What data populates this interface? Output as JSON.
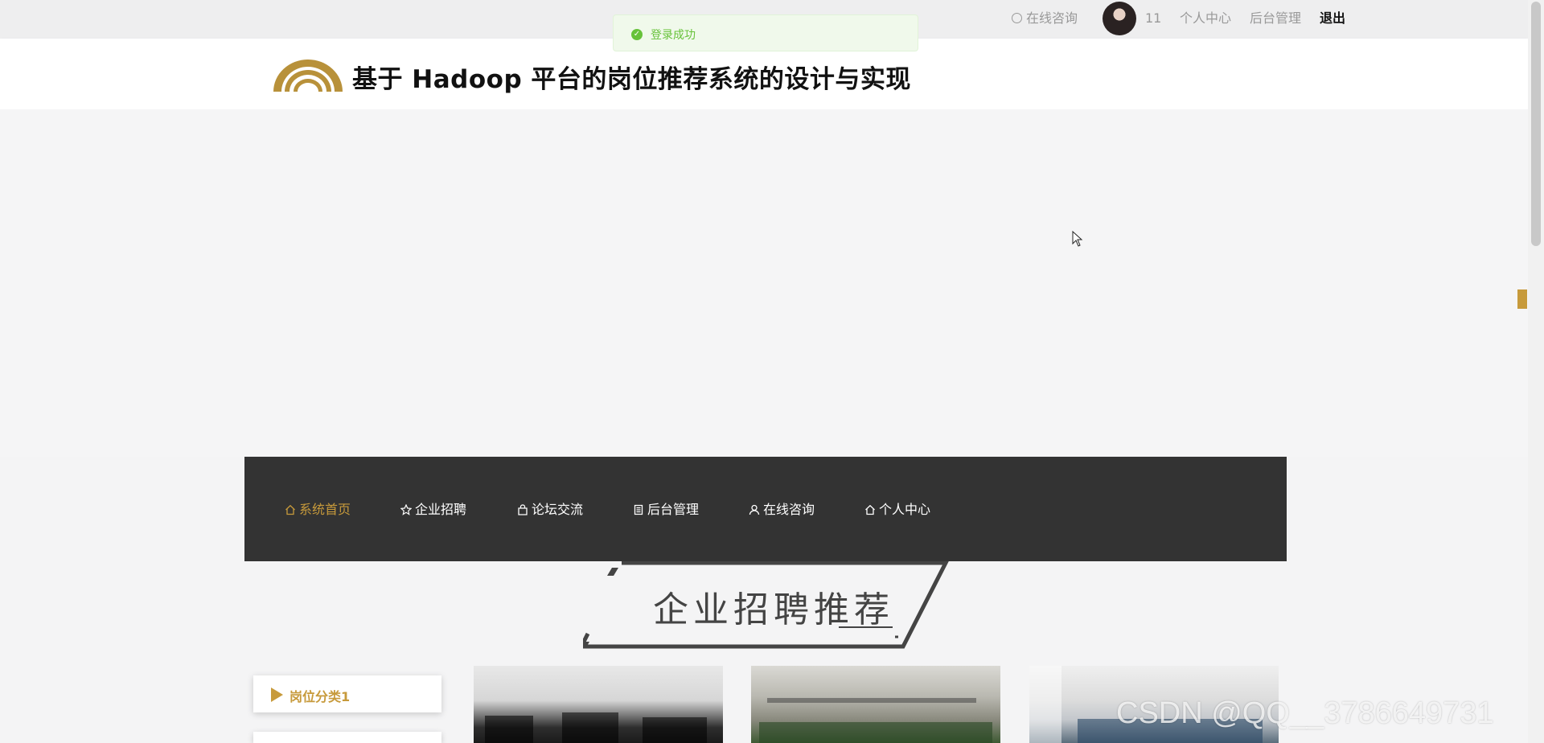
{
  "topbar": {
    "consult_label": "在线咨询",
    "username": "11",
    "personal_center": "个人中心",
    "admin": "后台管理",
    "logout": "退出"
  },
  "toast": {
    "message": "登录成功",
    "type": "success"
  },
  "header": {
    "title": "基于 Hadoop 平台的岗位推荐系统的设计与实现"
  },
  "nav": {
    "items": [
      {
        "label": "系统首页",
        "icon": "home-icon",
        "active": true
      },
      {
        "label": "企业招聘",
        "icon": "star-icon",
        "active": false
      },
      {
        "label": "论坛交流",
        "icon": "bag-icon",
        "active": false
      },
      {
        "label": "后台管理",
        "icon": "document-icon",
        "active": false
      },
      {
        "label": "在线咨询",
        "icon": "user-icon",
        "active": false
      },
      {
        "label": "个人中心",
        "icon": "home-icon",
        "active": false
      }
    ]
  },
  "section": {
    "title": "企业招聘推荐"
  },
  "category": {
    "first": "岗位分类1"
  },
  "watermark": "CSDN @QQ__3786649731",
  "colors": {
    "accent": "#c79a3b",
    "nav_bg": "#333333",
    "success": "#67c23a"
  }
}
